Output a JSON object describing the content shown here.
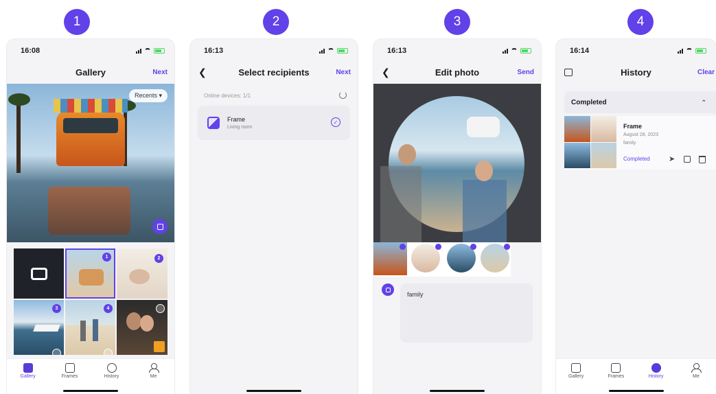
{
  "steps": [
    "1",
    "2",
    "3",
    "4"
  ],
  "screen1": {
    "time": "16:08",
    "title": "Gallery",
    "action": "Next",
    "recents": "Recents ▾",
    "badges": [
      "1",
      "2",
      "3",
      "4"
    ]
  },
  "screen2": {
    "time": "16:13",
    "title": "Select recipients",
    "action": "Next",
    "online": "Online devices: 1/1",
    "device_name": "Frame",
    "device_location": "Living room"
  },
  "screen3": {
    "time": "16:13",
    "title": "Edit photo",
    "action": "Send",
    "caption": "family"
  },
  "screen4": {
    "time": "16:14",
    "title": "History",
    "action": "Clear",
    "section": "Completed",
    "item_name": "Frame",
    "item_date": "August 28, 2023",
    "item_caption": "family",
    "item_status": "Completed"
  },
  "tabs": [
    "Gallery",
    "Frames",
    "History",
    "Me"
  ],
  "colors": {
    "accent": "#6141e8",
    "battery": "#4cd964"
  }
}
